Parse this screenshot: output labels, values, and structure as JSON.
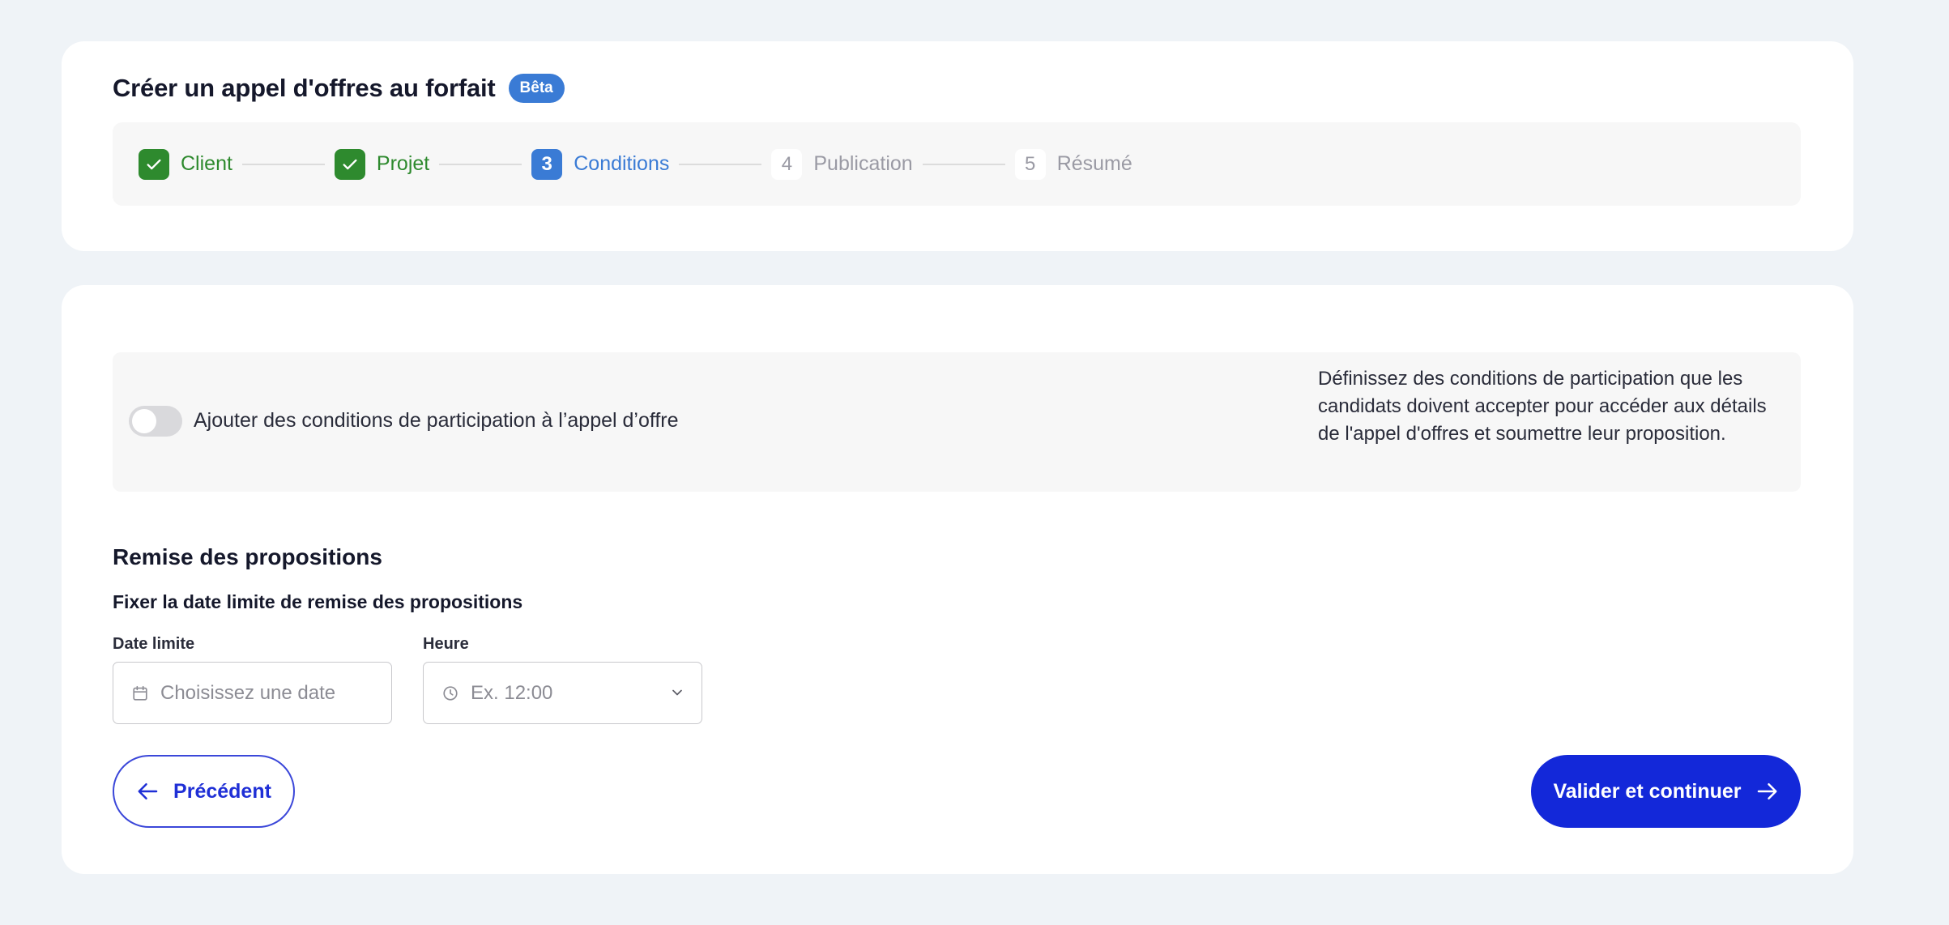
{
  "header": {
    "title": "Créer un appel d'offres au forfait",
    "badge": "Bêta"
  },
  "stepper": {
    "steps": [
      {
        "number": "1",
        "label": "Client",
        "state": "done"
      },
      {
        "number": "2",
        "label": "Projet",
        "state": "done"
      },
      {
        "number": "3",
        "label": "Conditions",
        "state": "active"
      },
      {
        "number": "4",
        "label": "Publication",
        "state": "todo"
      },
      {
        "number": "5",
        "label": "Résumé",
        "state": "todo"
      }
    ]
  },
  "conditions": {
    "toggle_label": "Ajouter des conditions de participation à l’appel d’offre",
    "toggle_on": false,
    "description": "Définissez des conditions de participation que les candidats doivent accepter pour accéder aux détails de l'appel d'offres et soumettre leur proposition."
  },
  "submission": {
    "title": "Remise des propositions",
    "subtitle": "Fixer la date limite de remise des propositions",
    "date_label": "Date limite",
    "date_placeholder": "Choisissez une date",
    "time_label": "Heure",
    "time_placeholder": "Ex. 12:00"
  },
  "actions": {
    "prev_label": "Précédent",
    "next_label": "Valider et continuer"
  },
  "colors": {
    "done": "#2e8a2e",
    "active": "#3a7bd5",
    "primary": "#1328d9",
    "background": "#eff3f7"
  },
  "icons": {
    "done_step": "check-icon",
    "date_field": "calendar-icon",
    "time_field": "clock-icon",
    "time_dropdown": "chevron-down-icon",
    "prev": "arrow-left-icon",
    "next": "arrow-right-icon"
  }
}
